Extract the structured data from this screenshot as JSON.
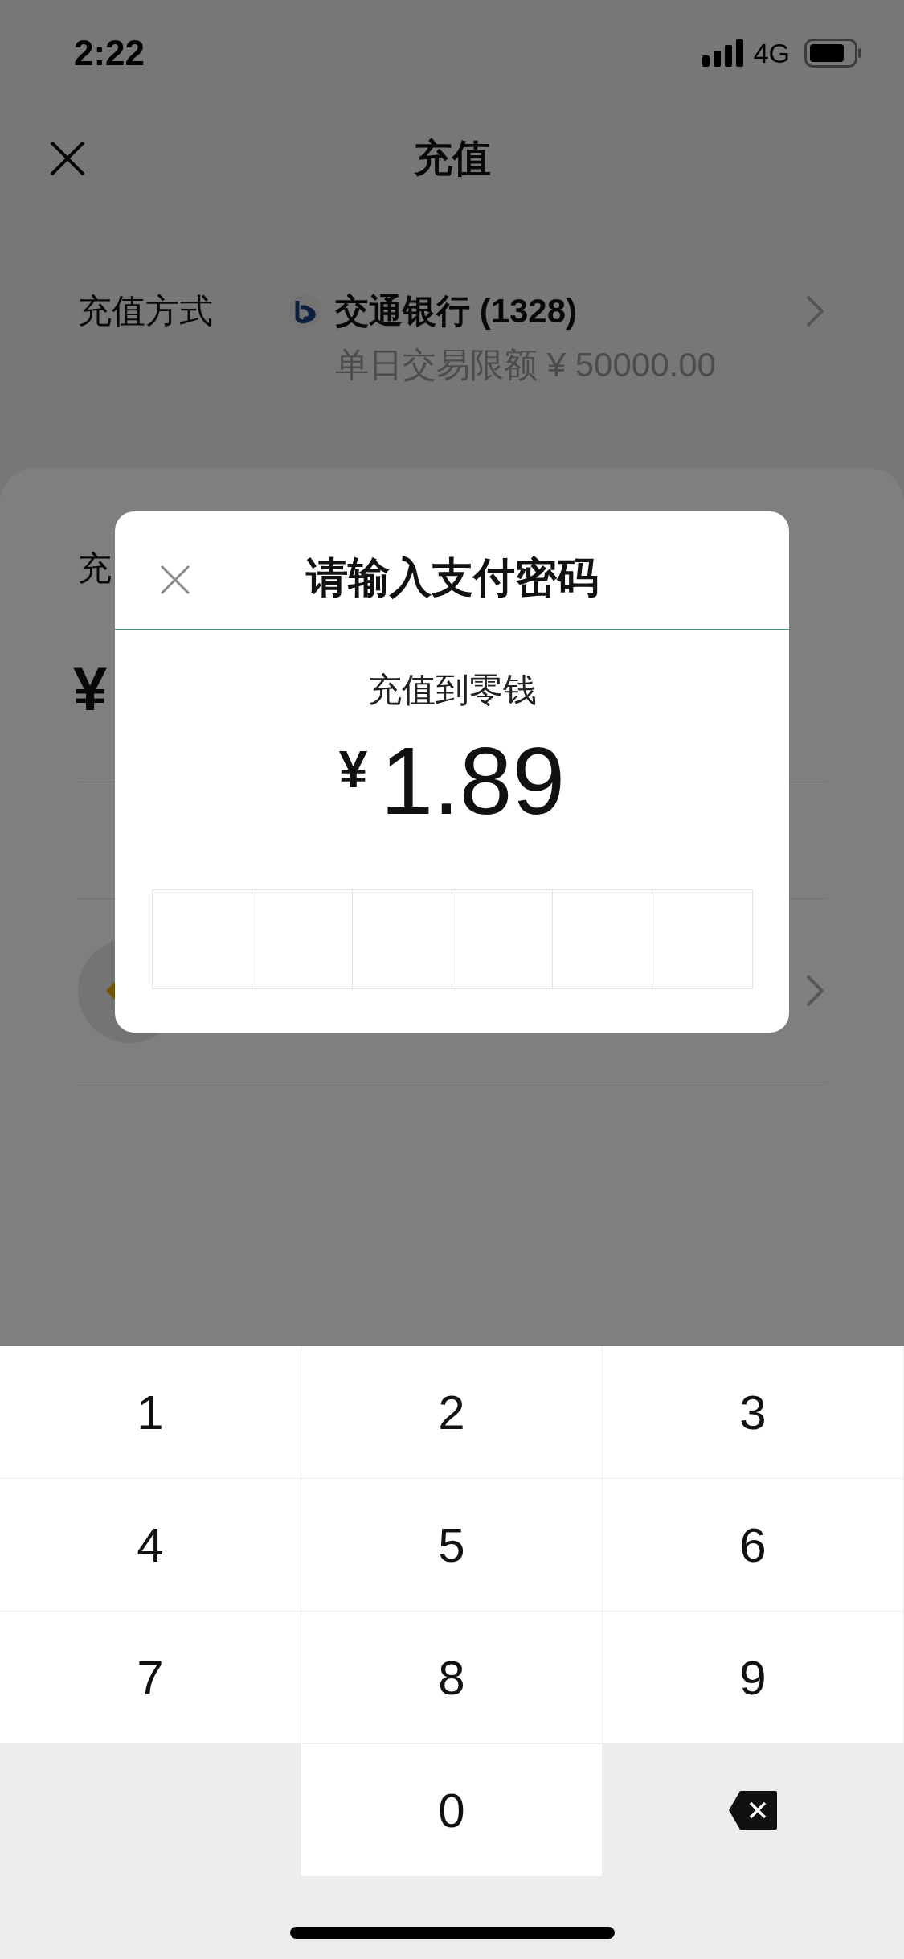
{
  "status_bar": {
    "time": "2:22",
    "network": "4G"
  },
  "header": {
    "title": "充值"
  },
  "payment_method": {
    "label": "充值方式",
    "bank": "交通银行 (1328)",
    "limit": "单日交易限额 ¥ 50000.00"
  },
  "amount_section": {
    "label": "充",
    "currency": "¥"
  },
  "dialog": {
    "title": "请输入支付密码",
    "subtitle": "充值到零钱",
    "currency": "¥",
    "amount": "1.89",
    "password_boxes": [
      {
        "filled": false
      },
      {
        "filled": false
      },
      {
        "filled": false
      },
      {
        "filled": false
      },
      {
        "filled": false
      },
      {
        "filled": false
      }
    ]
  },
  "keypad": [
    {
      "kind": "digit",
      "label": "1"
    },
    {
      "kind": "digit",
      "label": "2"
    },
    {
      "kind": "digit",
      "label": "3"
    },
    {
      "kind": "digit",
      "label": "4"
    },
    {
      "kind": "digit",
      "label": "5"
    },
    {
      "kind": "digit",
      "label": "6"
    },
    {
      "kind": "digit",
      "label": "7"
    },
    {
      "kind": "digit",
      "label": "8"
    },
    {
      "kind": "digit",
      "label": "9"
    },
    {
      "kind": "blank"
    },
    {
      "kind": "digit",
      "label": "0"
    },
    {
      "kind": "delete"
    }
  ]
}
